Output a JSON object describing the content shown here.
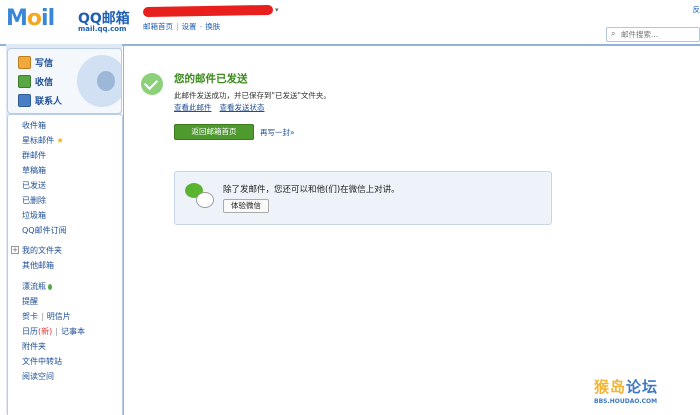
{
  "header": {
    "logo_mail": "M",
    "logo_mail_rest": "il",
    "logo_o": "o",
    "logo_qq": "QQ邮箱",
    "logo_domain": "mail.qq.com",
    "top_links": [
      "邮箱首页",
      "设置",
      "换肤"
    ],
    "corner_link": "反",
    "search_placeholder": "邮件搜索..."
  },
  "sidebar": {
    "compose": [
      "写信",
      "收信",
      "联系人"
    ],
    "folders": [
      "收件箱",
      "星标邮件",
      "群邮件",
      "草稿箱",
      "已发送",
      "已删除",
      "垃圾箱",
      "QQ邮件订阅"
    ],
    "my_folders": "我的文件夹",
    "other_mail": "其他邮箱",
    "apps": {
      "drift": "漂流瓶",
      "reminders": "提醒",
      "card": "贺卡",
      "postcard": "明信片",
      "calendar": "日历",
      "calendar_badge": "(新)",
      "notebook": "记事本",
      "attachments": "附件夹",
      "file_transfer": "文件中转站",
      "reading": "阅读空间"
    }
  },
  "main": {
    "title": "您的邮件已发送",
    "desc": "此邮件发送成功，并已保存到\"已发送\"文件夹。",
    "link_view_mail": "查看此邮件",
    "link_view_status": "查看发送状态",
    "btn_home": "返回邮箱首页",
    "link_again": "再写一封»",
    "wechat_text": "除了发邮件，您还可以和他(们)在微信上对讲。",
    "wechat_btn": "体验微信"
  },
  "watermark": {
    "big_a": "猴岛",
    "big_b": "论坛",
    "small": "BBS.HOUDAO.COM"
  }
}
